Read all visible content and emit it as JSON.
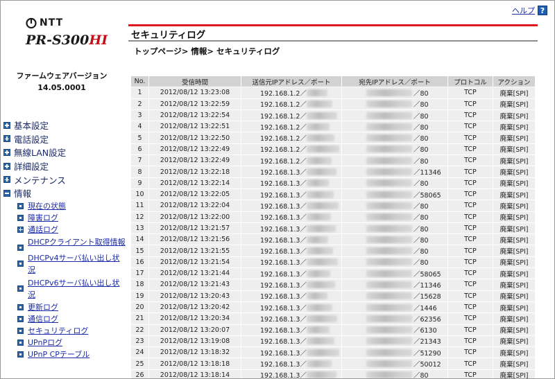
{
  "header": {
    "help_label": "ヘルプ",
    "help_icon": "?",
    "page_title": "セキュリティログ",
    "breadcrumb": "トップページ> 情報> セキュリティログ"
  },
  "brand": {
    "maker": "NTT",
    "model": "PR-S300",
    "model_suffix": "HI"
  },
  "firmware": {
    "label": "ファームウェアバージョン",
    "version": "14.05.0001"
  },
  "menu": [
    {
      "label": "基本設定",
      "icon": "plus"
    },
    {
      "label": "電話設定",
      "icon": "plus"
    },
    {
      "label": "無線LAN設定",
      "icon": "plus"
    },
    {
      "label": "詳細設定",
      "icon": "plus"
    },
    {
      "label": "メンテナンス",
      "icon": "plus"
    },
    {
      "label": "情報",
      "icon": "minus"
    }
  ],
  "submenu": [
    {
      "label": "現在の状態",
      "icon": "dot"
    },
    {
      "label": "障害ログ",
      "icon": "dot"
    },
    {
      "label": "通話ログ",
      "icon": "plus"
    },
    {
      "label": "DHCPクライアント取得情報",
      "icon": "dot"
    },
    {
      "label": "DHCPv4サーバ払い出し状況",
      "icon": "dot"
    },
    {
      "label": "DHCPv6サーバ払い出し状況",
      "icon": "dot"
    },
    {
      "label": "更新ログ",
      "icon": "dot"
    },
    {
      "label": "通信ログ",
      "icon": "dot"
    },
    {
      "label": "セキュリティログ",
      "icon": "dot"
    },
    {
      "label": "UPnPログ",
      "icon": "dot"
    },
    {
      "label": "UPnP CPテーブル",
      "icon": "dot"
    }
  ],
  "table": {
    "columns": [
      "No.",
      "受信時間",
      "送信元IPアドレス／ポート",
      "宛先IPアドレス／ポート",
      "プロトコル",
      "アクション"
    ],
    "rows": [
      {
        "no": "1",
        "time": "2012/08/12 13:23:08",
        "src": "192.168.1.2／",
        "dst": "／80",
        "proto": "TCP",
        "action": "廃棄[SPI]"
      },
      {
        "no": "2",
        "time": "2012/08/12 13:22:59",
        "src": "192.168.1.2／",
        "dst": "／80",
        "proto": "TCP",
        "action": "廃棄[SPI]"
      },
      {
        "no": "3",
        "time": "2012/08/12 13:22:54",
        "src": "192.168.1.2／",
        "dst": "／80",
        "proto": "TCP",
        "action": "廃棄[SPI]"
      },
      {
        "no": "4",
        "time": "2012/08/12 13:22:51",
        "src": "192.168.1.2／",
        "dst": "／80",
        "proto": "TCP",
        "action": "廃棄[SPI]"
      },
      {
        "no": "5",
        "time": "2012/08/12 13:22:50",
        "src": "192.168.1.2／",
        "dst": "／80",
        "proto": "TCP",
        "action": "廃棄[SPI]"
      },
      {
        "no": "6",
        "time": "2012/08/12 13:22:49",
        "src": "192.168.1.2／",
        "dst": "／80",
        "proto": "TCP",
        "action": "廃棄[SPI]"
      },
      {
        "no": "7",
        "time": "2012/08/12 13:22:49",
        "src": "192.168.1.2／",
        "dst": "／80",
        "proto": "TCP",
        "action": "廃棄[SPI]"
      },
      {
        "no": "8",
        "time": "2012/08/12 13:22:18",
        "src": "192.168.1.3／",
        "dst": "／11346",
        "proto": "TCP",
        "action": "廃棄[SPI]"
      },
      {
        "no": "9",
        "time": "2012/08/12 13:22:14",
        "src": "192.168.1.3／",
        "dst": "／80",
        "proto": "TCP",
        "action": "廃棄[SPI]"
      },
      {
        "no": "10",
        "time": "2012/08/12 13:22:05",
        "src": "192.168.1.3／",
        "dst": "／58065",
        "proto": "TCP",
        "action": "廃棄[SPI]"
      },
      {
        "no": "11",
        "time": "2012/08/12 13:22:04",
        "src": "192.168.1.3／",
        "dst": "／80",
        "proto": "TCP",
        "action": "廃棄[SPI]"
      },
      {
        "no": "12",
        "time": "2012/08/12 13:22:00",
        "src": "192.168.1.3／",
        "dst": "／80",
        "proto": "TCP",
        "action": "廃棄[SPI]"
      },
      {
        "no": "13",
        "time": "2012/08/12 13:21:57",
        "src": "192.168.1.3／",
        "dst": "／80",
        "proto": "TCP",
        "action": "廃棄[SPI]"
      },
      {
        "no": "14",
        "time": "2012/08/12 13:21:56",
        "src": "192.168.1.3／",
        "dst": "／80",
        "proto": "TCP",
        "action": "廃棄[SPI]"
      },
      {
        "no": "15",
        "time": "2012/08/12 13:21:55",
        "src": "192.168.1.3／",
        "dst": "／80",
        "proto": "TCP",
        "action": "廃棄[SPI]"
      },
      {
        "no": "16",
        "time": "2012/08/12 13:21:54",
        "src": "192.168.1.3／",
        "dst": "／80",
        "proto": "TCP",
        "action": "廃棄[SPI]"
      },
      {
        "no": "17",
        "time": "2012/08/12 13:21:44",
        "src": "192.168.1.3／",
        "dst": "／58065",
        "proto": "TCP",
        "action": "廃棄[SPI]"
      },
      {
        "no": "18",
        "time": "2012/08/12 13:21:43",
        "src": "192.168.1.3／",
        "dst": "／11346",
        "proto": "TCP",
        "action": "廃棄[SPI]"
      },
      {
        "no": "19",
        "time": "2012/08/12 13:20:43",
        "src": "192.168.1.3／",
        "dst": "／15628",
        "proto": "TCP",
        "action": "廃棄[SPI]"
      },
      {
        "no": "20",
        "time": "2012/08/12 13:20:42",
        "src": "192.168.1.3／",
        "dst": "／1446",
        "proto": "TCP",
        "action": "廃棄[SPI]"
      },
      {
        "no": "21",
        "time": "2012/08/12 13:20:34",
        "src": "192.168.1.3／",
        "dst": "／62356",
        "proto": "TCP",
        "action": "廃棄[SPI]"
      },
      {
        "no": "22",
        "time": "2012/08/12 13:20:07",
        "src": "192.168.1.3／",
        "dst": "／6130",
        "proto": "TCP",
        "action": "廃棄[SPI]"
      },
      {
        "no": "23",
        "time": "2012/08/12 13:19:08",
        "src": "192.168.1.3／",
        "dst": "／21343",
        "proto": "TCP",
        "action": "廃棄[SPI]"
      },
      {
        "no": "24",
        "time": "2012/08/12 13:18:32",
        "src": "192.168.1.3／",
        "dst": "／51290",
        "proto": "TCP",
        "action": "廃棄[SPI]"
      },
      {
        "no": "25",
        "time": "2012/08/12 13:18:18",
        "src": "192.168.1.3／",
        "dst": "／50012",
        "proto": "TCP",
        "action": "廃棄[SPI]"
      },
      {
        "no": "26",
        "time": "2012/08/12 13:18:14",
        "src": "192.168.1.3／",
        "dst": "／80",
        "proto": "TCP",
        "action": "廃棄[SPI]"
      }
    ]
  },
  "colors": {
    "accent_red": "#e0191f",
    "menu_icon": "#2c64a8",
    "link": "#1a2aa8"
  }
}
